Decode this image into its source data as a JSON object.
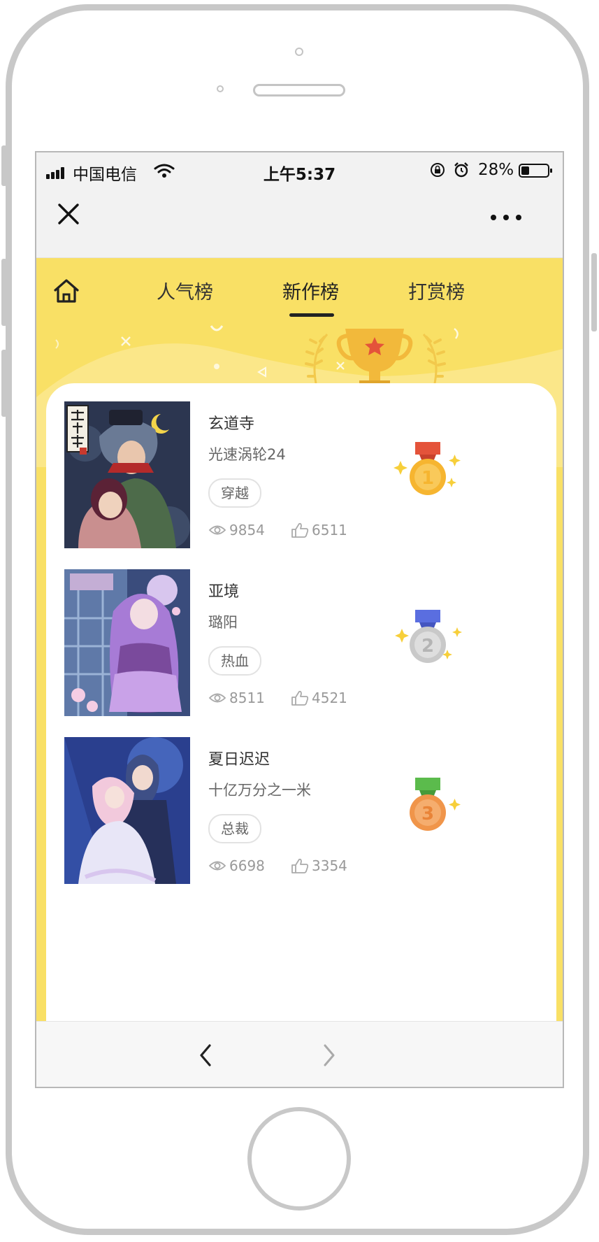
{
  "status_bar": {
    "carrier": "中国电信",
    "time": "上午5:37",
    "battery_percent": "28%",
    "battery_level": 0.28,
    "icons": [
      "signal-icon",
      "wifi-icon",
      "orientation-lock-icon",
      "alarm-icon",
      "battery-icon"
    ]
  },
  "nav_bar": {
    "icons": [
      "close-icon",
      "more-icon"
    ]
  },
  "tabs": {
    "items": [
      {
        "label": "人气榜",
        "active": false
      },
      {
        "label": "新作榜",
        "active": true
      },
      {
        "label": "打赏榜",
        "active": false
      }
    ]
  },
  "colors": {
    "brand_yellow": "#f9e065",
    "gold": "#f2b93b",
    "silver": "#c9c9c9",
    "bronze": "#f0954a",
    "ribbon_red": "#e4533a",
    "ribbon_blue": "#5a6ee0",
    "ribbon_green": "#5bbb4c"
  },
  "comics": [
    {
      "rank": "1",
      "title": "玄道寺",
      "author": "光速涡轮24",
      "tag": "穿越",
      "views": "9854",
      "likes": "6511"
    },
    {
      "rank": "2",
      "title": "亚境",
      "author": "璐阳",
      "tag": "热血",
      "views": "8511",
      "likes": "4521"
    },
    {
      "rank": "3",
      "title": "夏日迟迟",
      "author": "十亿万分之一米",
      "tag": "总裁",
      "views": "6698",
      "likes": "3354"
    }
  ],
  "cover_lettering": {
    "comic_1": "玄道寺"
  },
  "bottom_nav": {
    "icons": [
      "back-arrow-icon",
      "forward-arrow-icon"
    ]
  }
}
